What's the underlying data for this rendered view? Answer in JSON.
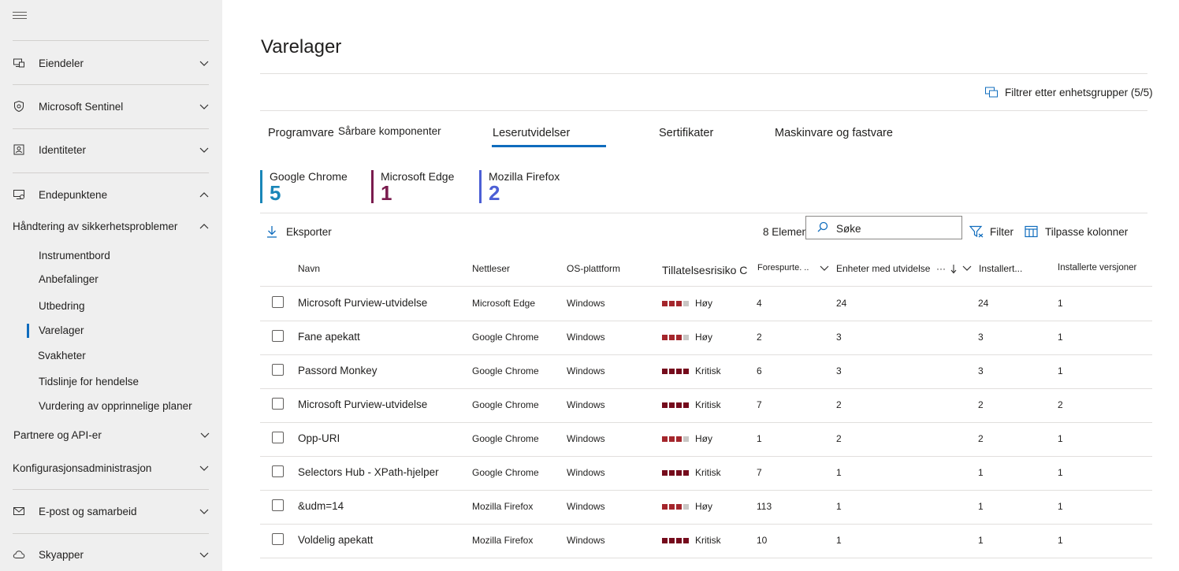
{
  "sidebar": {
    "groups": [
      {
        "label": "Eiendeler",
        "icon": "devices-icon"
      },
      {
        "label": "Microsoft Sentinel",
        "icon": "shield-icon"
      },
      {
        "label": "Identiteter",
        "icon": "identity-icon"
      },
      {
        "label": "Endepunktene",
        "icon": "endpoint-icon"
      }
    ],
    "section": "Håndtering av sikkerhetsproblemer",
    "sub_items": [
      "Instrumentbord",
      "Anbefalinger",
      "Utbedring",
      "Varelager",
      "Svakheter",
      "Tidslinje for hendelse",
      "Vurdering av opprinnelige planer"
    ],
    "active_sub": "Varelager",
    "bottom_groups": [
      {
        "label": "Partnere og API-er"
      },
      {
        "label": "Konfigurasjonsadministrasjon"
      },
      {
        "label": "E-post og samarbeid",
        "icon": "mail-icon"
      },
      {
        "label": "Skyapper",
        "icon": "cloud-icon"
      }
    ]
  },
  "page": {
    "title": "Varelager",
    "device_group_filter": "Filtrer etter enhetsgrupper (5/5)"
  },
  "tabs": {
    "programvare": "Programvare",
    "sarbare": "Sårbare komponenter",
    "leserutvidelser": "Leserutvidelser",
    "sertifikater": "Sertifikater",
    "maskinvare": "Maskinvare og fastvare",
    "active": "Leserutvidelser"
  },
  "browsers": [
    {
      "name": "Google Chrome",
      "count": "5",
      "color": "#1a86b8"
    },
    {
      "name": "Microsoft Edge",
      "count": "1",
      "color": "#7a1c4e"
    },
    {
      "name": "Mozilla Firefox",
      "count": "2",
      "color": "#4c5fd5"
    }
  ],
  "toolbar": {
    "export": "Eksporter",
    "items_count": "8 Elementer",
    "search_placeholder": "Søke",
    "filter": "Filter",
    "customize": "Tilpasse kolonner"
  },
  "table": {
    "headers": {
      "name": "Navn",
      "browser": "Nettleser",
      "os": "OS-plattform",
      "risk": "Tillatelsesrisiko C",
      "requests": "Forespurte. ..",
      "devices": "Enheter med utvidelse",
      "installed": "Installert...",
      "versions": "Installerte versjoner"
    },
    "rows": [
      {
        "name": "Microsoft Purview-utvidelse",
        "browser": "Microsoft Edge",
        "os": "Windows",
        "risk": "Høy",
        "requests": "4",
        "devices": "24",
        "installed": "24",
        "versions": "1"
      },
      {
        "name": "Fane apekatt",
        "browser": "Google Chrome",
        "os": "Windows",
        "risk": "Høy",
        "requests": "2",
        "devices": "3",
        "installed": "3",
        "versions": "1"
      },
      {
        "name": "Passord Monkey",
        "browser": "Google Chrome",
        "os": "Windows",
        "risk": "Kritisk",
        "requests": "6",
        "devices": "3",
        "installed": "3",
        "versions": "1"
      },
      {
        "name": "Microsoft Purview-utvidelse",
        "browser": "Google Chrome",
        "os": "Windows",
        "risk": "Kritisk",
        "requests": "7",
        "devices": "2",
        "installed": "2",
        "versions": "2"
      },
      {
        "name": "Opp-URI",
        "browser": "Google Chrome",
        "os": "Windows",
        "risk": "Høy",
        "requests": "1",
        "devices": "2",
        "installed": "2",
        "versions": "1"
      },
      {
        "name": "Selectors Hub - XPath-hjelper",
        "browser": "Google Chrome",
        "os": "Windows",
        "risk": "Kritisk",
        "requests": "7",
        "devices": "1",
        "installed": "1",
        "versions": "1"
      },
      {
        "name": "&udm=14",
        "browser": "Mozilla Firefox",
        "os": "Windows",
        "risk": "Høy",
        "requests": "113",
        "devices": "1",
        "installed": "1",
        "versions": "1"
      },
      {
        "name": "Voldelig apekatt",
        "browser": "Mozilla Firefox",
        "os": "Windows",
        "risk": "Kritisk",
        "requests": "10",
        "devices": "1",
        "installed": "1",
        "versions": "1"
      }
    ]
  },
  "colors": {
    "accent": "#0f6cbd",
    "risk_high": "#a4262c",
    "risk_critical": "#750b1c",
    "risk_empty": "#c8c6c4"
  }
}
